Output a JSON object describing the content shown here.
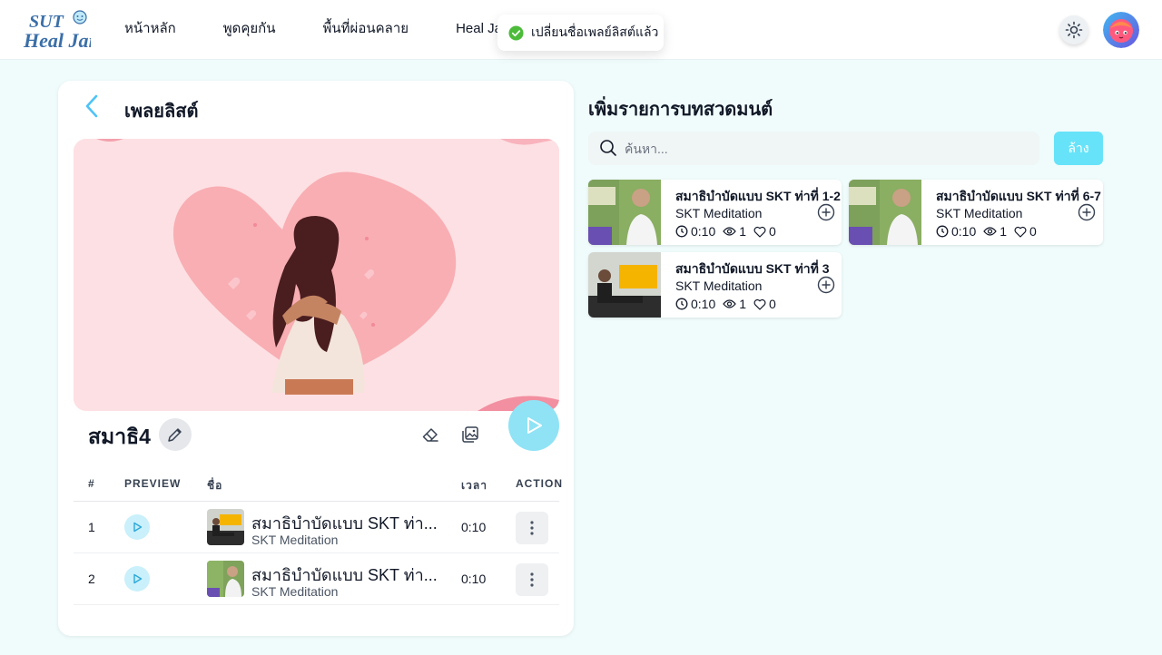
{
  "header": {
    "logo_text_top": "SUT",
    "logo_text_bottom": "Heal Jai",
    "nav": [
      "หน้าหลัก",
      "พูดคุยกัน",
      "พื้นที่ผ่อนคลาย",
      "Heal Jai Ca"
    ]
  },
  "toast": {
    "message": "เปลี่ยนชื่อเพลย์ลิสต์แล้ว"
  },
  "playlist": {
    "title": "เพลยลิสต์",
    "name": "สมาธิ4",
    "columns": {
      "num": "#",
      "preview": "PREVIEW",
      "name": "ชื่อ",
      "duration": "เวลา",
      "action": "ACTION"
    },
    "rows": [
      {
        "num": "1",
        "title": "สมาธิบำบัดแบบ SKT ท่า...",
        "subtitle": "SKT Meditation",
        "duration": "0:10"
      },
      {
        "num": "2",
        "title": "สมาธิบำบัดแบบ SKT ท่า...",
        "subtitle": "SKT Meditation",
        "duration": "0:10"
      }
    ]
  },
  "add_panel": {
    "title": "เพิ่มรายการบทสวดมนต์",
    "search_placeholder": "ค้นหา...",
    "clear_label": "ล้าง",
    "items": [
      {
        "title": "สมาธิบำบัดแบบ SKT ท่าที่ 1-2",
        "subtitle": "SKT Meditation",
        "duration": "0:10",
        "views": "1",
        "likes": "0"
      },
      {
        "title": "สมาธิบำบัดแบบ SKT ท่าที่ 6-7",
        "subtitle": "SKT Meditation",
        "duration": "0:10",
        "views": "1",
        "likes": "0"
      },
      {
        "title": "สมาธิบำบัดแบบ SKT ท่าที่ 3",
        "subtitle": "SKT Meditation",
        "duration": "0:10",
        "views": "1",
        "likes": "0"
      }
    ]
  },
  "colors": {
    "accent": "#5ad8f2",
    "play_button": "#8fe3f5",
    "background": "#f0fcfc",
    "cover_bg": "#fde0e3"
  }
}
